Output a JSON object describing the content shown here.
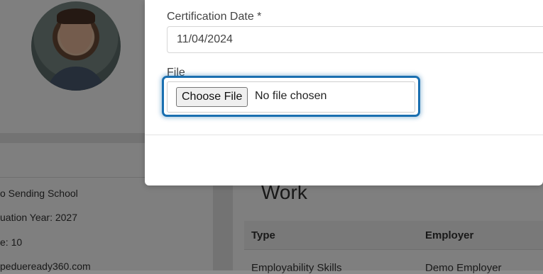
{
  "background": {
    "details": [
      "o Sending School",
      "uation Year: 2027",
      "e: 10",
      "pedueready360.com"
    ],
    "work_title": "Work",
    "table": {
      "headers": [
        "Type",
        "Employer"
      ],
      "first_row": [
        "Employability Skills",
        "Demo Employer"
      ]
    }
  },
  "modal": {
    "cert_date_label": "Certification Date *",
    "cert_date_value": "11/04/2024",
    "file_label": "File",
    "choose_file_label": "Choose File",
    "no_file_text": "No file chosen"
  },
  "colors": {
    "focus_ring": "#1a6fb0",
    "overlay": "rgba(0,0,0,0.5)"
  }
}
